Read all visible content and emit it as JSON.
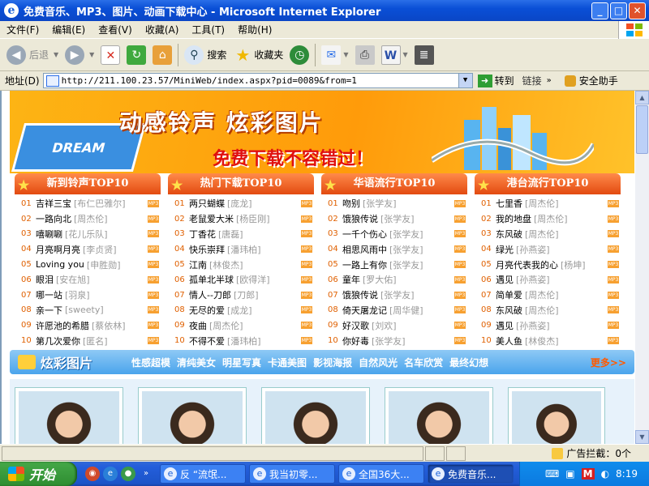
{
  "window": {
    "title": "免费音乐、MP3、图片、动画下载中心 - Microsoft Internet Explorer",
    "minimize": "_",
    "maximize": "□",
    "close": "✕"
  },
  "menu": [
    "文件(F)",
    "编辑(E)",
    "查看(V)",
    "收藏(A)",
    "工具(T)",
    "帮助(H)"
  ],
  "toolbar": {
    "back": "后退",
    "search": "搜索",
    "favorites": "收藏夹"
  },
  "address": {
    "label": "地址(D)",
    "url": "http://211.100.23.57/MiniWeb/index.aspx?pid=0089&from=1",
    "go": "转到",
    "links": "链接",
    "helper": "安全助手"
  },
  "banner": {
    "dream": "DREAM",
    "title": "动感铃声 炫彩图片",
    "slogan": "免费下载不容错过！"
  },
  "columns": [
    {
      "title": "新到铃声TOP10",
      "items": [
        {
          "n": "01",
          "song": "吉祥三宝",
          "artist": "[布仁巴雅尔]"
        },
        {
          "n": "02",
          "song": "一路向北",
          "artist": "[周杰伦]"
        },
        {
          "n": "03",
          "song": "嘻唰唰",
          "artist": "[花儿乐队]"
        },
        {
          "n": "04",
          "song": "月亮啊月亮",
          "artist": "[李贞贤]"
        },
        {
          "n": "05",
          "song": "Loving you",
          "artist": "[申胜勋]"
        },
        {
          "n": "06",
          "song": "眼泪",
          "artist": "[安在旭]"
        },
        {
          "n": "07",
          "song": "哪一站",
          "artist": "[羽泉]"
        },
        {
          "n": "08",
          "song": "亲一下",
          "artist": "[sweety]"
        },
        {
          "n": "09",
          "song": "许愿池的希腊",
          "artist": "[蔡依林]"
        },
        {
          "n": "10",
          "song": "第几次爱你",
          "artist": "[匿名]"
        }
      ]
    },
    {
      "title": "热门下载TOP10",
      "items": [
        {
          "n": "01",
          "song": "两只蝴蝶",
          "artist": "[庞龙]"
        },
        {
          "n": "02",
          "song": "老鼠爱大米",
          "artist": "[杨臣刚]"
        },
        {
          "n": "03",
          "song": "丁香花",
          "artist": "[唐磊]"
        },
        {
          "n": "04",
          "song": "快乐崇拜",
          "artist": "[潘玮柏]"
        },
        {
          "n": "05",
          "song": "江南",
          "artist": "[林俊杰]"
        },
        {
          "n": "06",
          "song": "孤单北半球",
          "artist": "[欧得洋]"
        },
        {
          "n": "07",
          "song": "情人--刀郎",
          "artist": "[刀郎]"
        },
        {
          "n": "08",
          "song": "无尽的爱",
          "artist": "[成龙]"
        },
        {
          "n": "09",
          "song": "夜曲",
          "artist": "[周杰伦]"
        },
        {
          "n": "10",
          "song": "不得不爱",
          "artist": "[潘玮柏]"
        }
      ]
    },
    {
      "title": "华语流行TOP10",
      "items": [
        {
          "n": "01",
          "song": "吻别",
          "artist": "[张学友]"
        },
        {
          "n": "02",
          "song": "饿狼传说",
          "artist": "[张学友]"
        },
        {
          "n": "03",
          "song": "一千个伤心",
          "artist": "[张学友]"
        },
        {
          "n": "04",
          "song": "相思风雨中",
          "artist": "[张学友]"
        },
        {
          "n": "05",
          "song": "一路上有你",
          "artist": "[张学友]"
        },
        {
          "n": "06",
          "song": "童年",
          "artist": "[罗大佑]"
        },
        {
          "n": "07",
          "song": "饿狼传说",
          "artist": "[张学友]"
        },
        {
          "n": "08",
          "song": "倚天屠龙记",
          "artist": "[周华健]"
        },
        {
          "n": "09",
          "song": "好汉歌",
          "artist": "[刘欢]"
        },
        {
          "n": "10",
          "song": "你好毒",
          "artist": "[张学友]"
        }
      ]
    },
    {
      "title": "港台流行TOP10",
      "items": [
        {
          "n": "01",
          "song": "七里香",
          "artist": "[周杰伦]"
        },
        {
          "n": "02",
          "song": "我的地盘",
          "artist": "[周杰伦]"
        },
        {
          "n": "03",
          "song": "东风破",
          "artist": "[周杰伦]"
        },
        {
          "n": "04",
          "song": "绿光",
          "artist": "[孙燕姿]"
        },
        {
          "n": "05",
          "song": "月亮代表我的心",
          "artist": "[杨坤]"
        },
        {
          "n": "06",
          "song": "遇见",
          "artist": "[孙燕姿]"
        },
        {
          "n": "07",
          "song": "简单爱",
          "artist": "[周杰伦]"
        },
        {
          "n": "08",
          "song": "东风破",
          "artist": "[周杰伦]"
        },
        {
          "n": "09",
          "song": "遇见",
          "artist": "[孙燕姿]"
        },
        {
          "n": "10",
          "song": "美人鱼",
          "artist": "[林俊杰]"
        }
      ]
    }
  ],
  "mp3_badge": "MP3",
  "pictures": {
    "title": "炫彩图片",
    "categories": [
      "性感超模",
      "清纯美女",
      "明星写真",
      "卡通美图",
      "影视海报",
      "自然风光",
      "名车欣赏",
      "最终幻想"
    ],
    "more": "更多>>"
  },
  "status": {
    "popup_blocker": "广告拦截：0个"
  },
  "taskbar": {
    "start": "开始",
    "tasks": [
      "反 “流氓...",
      "我当初零...",
      "全国36大...",
      "免费音乐..."
    ],
    "time": "8:19"
  },
  "colors": {
    "title_blue": "#0a4fd6",
    "accent_orange": "#e24a10",
    "picbar_blue": "#4aa4ec"
  }
}
